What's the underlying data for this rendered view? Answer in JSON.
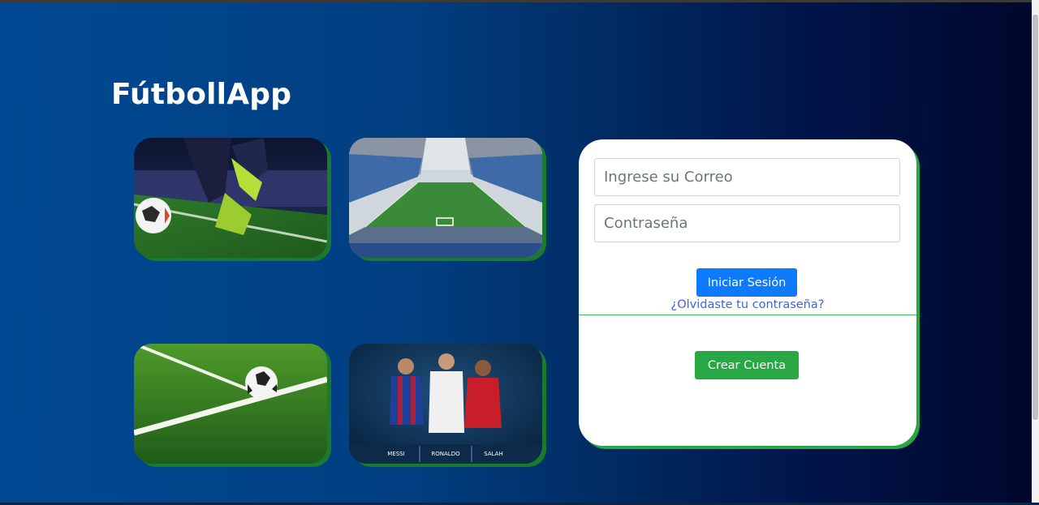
{
  "app": {
    "title": "FútbollApp"
  },
  "gallery": [
    {
      "name": "player-kicking-ball-photo"
    },
    {
      "name": "stadium-photo"
    },
    {
      "name": "ball-on-pitch-photo"
    },
    {
      "name": "players-poster-photo",
      "labels": [
        "MESSI",
        "RONALDO",
        "SALAH"
      ]
    }
  ],
  "login": {
    "email_placeholder": "Ingrese su Correo",
    "password_placeholder": "Contraseña",
    "login_button": "Iniciar Sesión",
    "forgot_link": "¿Olvidaste tu contraseña?",
    "create_button": "Crear Cuenta"
  },
  "colors": {
    "primary": "#0d7bfb",
    "success": "#28a745",
    "link": "#3d64d8",
    "card_shadow": "#27a844"
  }
}
